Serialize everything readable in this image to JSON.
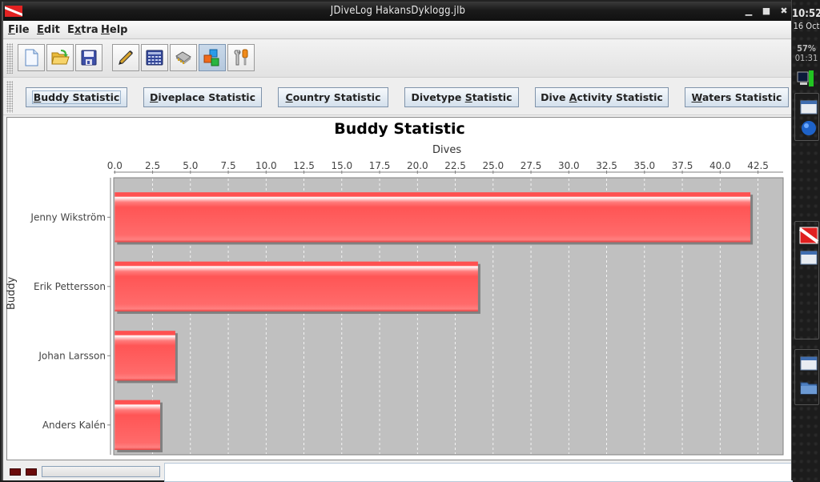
{
  "window": {
    "title": "JDiveLog HakansDyklogg.jlb",
    "controls": [
      "minimize",
      "maximize",
      "close"
    ]
  },
  "menubar": {
    "items": [
      {
        "label": "File",
        "mnemonic": "F"
      },
      {
        "label": "Edit",
        "mnemonic": "E"
      },
      {
        "label": "Extra",
        "mnemonic": "x"
      },
      {
        "label": "Help",
        "mnemonic": "H"
      }
    ]
  },
  "toolbar": {
    "buttons": [
      {
        "name": "new-file",
        "icon": "new-document-icon"
      },
      {
        "name": "open-file",
        "icon": "open-folder-icon"
      },
      {
        "name": "save-file",
        "icon": "floppy-disk-icon"
      },
      {
        "name": "edit-logbook",
        "icon": "pen-icon"
      },
      {
        "name": "calculator",
        "icon": "calculator-icon"
      },
      {
        "name": "dive-computer",
        "icon": "chip-icon"
      },
      {
        "name": "statistics",
        "icon": "cubes-icon",
        "active": true
      },
      {
        "name": "settings",
        "icon": "tools-icon"
      }
    ]
  },
  "statistic_buttons": [
    {
      "label": "Buddy Statistic",
      "mnemonic_index": 0,
      "focused": true
    },
    {
      "label": "Diveplace Statistic",
      "mnemonic_index": 0
    },
    {
      "label": "Country Statistic",
      "mnemonic_index": 0
    },
    {
      "label": "Divetype Statistic",
      "mnemonic_index": 9
    },
    {
      "label": "Dive Activity Statistic",
      "mnemonic_index": 5
    },
    {
      "label": "Waters Statistic",
      "mnemonic_index": 0
    }
  ],
  "chart_data": {
    "type": "bar",
    "orientation": "horizontal",
    "title": "Buddy Statistic",
    "xlabel": "Dives",
    "ylabel": "Buddy",
    "categories": [
      "Jenny Wikström",
      "Erik Pettersson",
      "Johan Larsson",
      "Anders Kalén"
    ],
    "values": [
      42,
      24,
      4,
      3
    ],
    "xlim": [
      0,
      44.1
    ],
    "xticks": [
      "0.0",
      "2.5",
      "5.0",
      "7.5",
      "10.0",
      "12.5",
      "15.0",
      "17.5",
      "20.0",
      "22.5",
      "25.0",
      "27.5",
      "30.0",
      "32.5",
      "35.0",
      "37.5",
      "40.0",
      "42.5"
    ],
    "xtick_values": [
      0,
      2.5,
      5,
      7.5,
      10,
      12.5,
      15,
      17.5,
      20,
      22.5,
      25,
      27.5,
      30,
      32.5,
      35,
      37.5,
      40,
      42.5
    ],
    "x_axis_position": "top",
    "grid": true,
    "legend": "none",
    "colors": {
      "bar": "#ff5555",
      "plot_background": "#c0c0c0",
      "gridline": "#ffffff"
    }
  },
  "statusbar": {
    "status_text": "",
    "progress": 0
  },
  "system_panel": {
    "time": "10:52",
    "date": "16 Oct",
    "battery": "57%",
    "battery_time": "01:31"
  }
}
